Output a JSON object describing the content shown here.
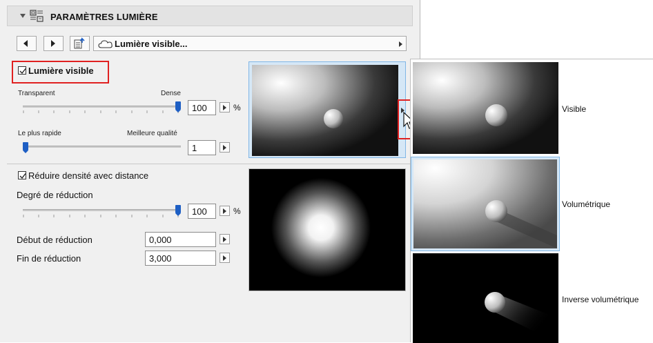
{
  "panel": {
    "title": "PARAMÈTRES LUMIÈRE",
    "icons": {
      "collapse": "triangle-down",
      "header": "light-settings-icon",
      "settings": "settings-arrow-icon",
      "cloud": "cloud-icon"
    },
    "preset_name": "Lumière visible...",
    "visible_light": {
      "checkbox_label": "Lumière visible",
      "checked": true,
      "density": {
        "left_label": "Transparent",
        "right_label": "Dense",
        "value": "100",
        "unit": "%",
        "level": 1.0
      },
      "quality": {
        "left_label": "Le plus rapide",
        "right_label": "Meilleure qualité",
        "value": "1",
        "level": 0.0
      }
    },
    "reduction": {
      "checkbox_label": "Réduire densité avec distance",
      "checked": true,
      "degree_label": "Degré de réduction",
      "degree": {
        "value": "100",
        "unit": "%",
        "level": 1.0
      },
      "start_label": "Début de réduction",
      "start_value": "0,000",
      "end_label": "Fin de réduction",
      "end_value": "3,000"
    }
  },
  "popup": {
    "options": [
      {
        "label": "Visible",
        "selected": false
      },
      {
        "label": "Volumétrique",
        "selected": true
      },
      {
        "label": "Inverse volumétrique",
        "selected": false
      }
    ]
  },
  "colors": {
    "accent": "#1e5fc4",
    "highlight": "#e02020",
    "selection": "#7fb6e6"
  }
}
